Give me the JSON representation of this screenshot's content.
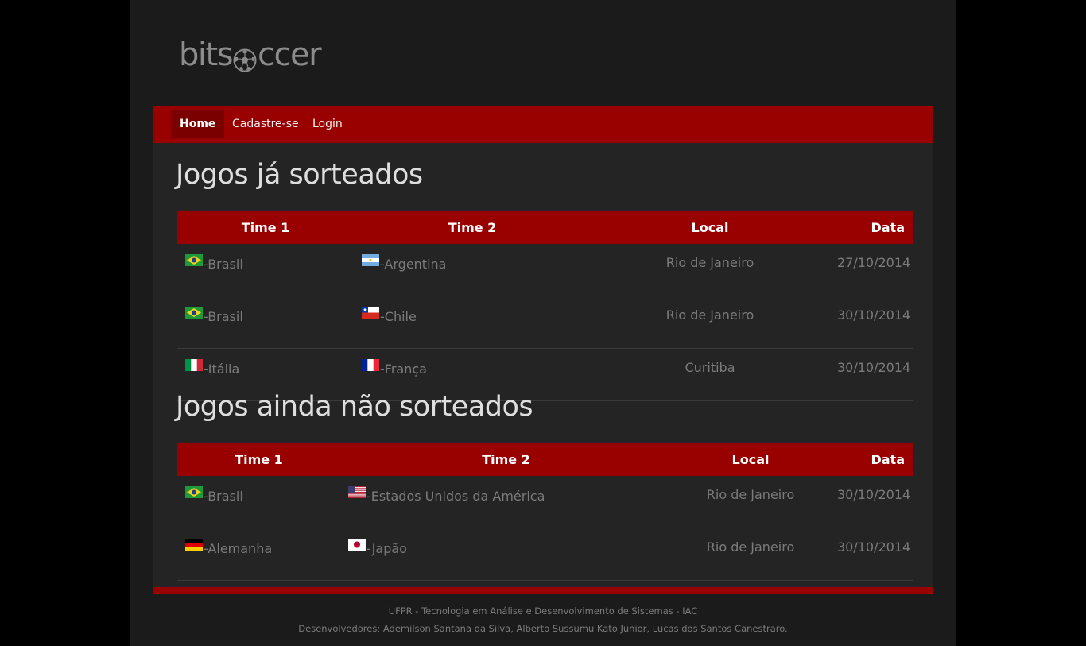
{
  "brand": {
    "logo_text_left": "bits",
    "logo_text_right": "ccer",
    "ball_icon": "soccer-ball-icon"
  },
  "nav": {
    "items": [
      {
        "label": "Home",
        "active": true
      },
      {
        "label": "Cadastre-se",
        "active": false
      },
      {
        "label": "Login",
        "active": false
      }
    ]
  },
  "drawn": {
    "title": "Jogos já sorteados",
    "headers": [
      "Time 1",
      "Time 2",
      "Local",
      "Data"
    ],
    "rows": [
      {
        "team1": {
          "flag": "brazil-flag-icon",
          "name": "-Brasil"
        },
        "team2": {
          "flag": "argentina-flag-icon",
          "name": "-Argentina"
        },
        "local": "Rio de Janeiro",
        "data": "27/10/2014"
      },
      {
        "team1": {
          "flag": "brazil-flag-icon",
          "name": "-Brasil"
        },
        "team2": {
          "flag": "chile-flag-icon",
          "name": "-Chile"
        },
        "local": "Rio de Janeiro",
        "data": "30/10/2014"
      },
      {
        "team1": {
          "flag": "italy-flag-icon",
          "name": "-Itália"
        },
        "team2": {
          "flag": "france-flag-icon",
          "name": "-França"
        },
        "local": "Curitiba",
        "data": "30/10/2014"
      }
    ]
  },
  "not_drawn": {
    "title": "Jogos ainda não sorteados",
    "headers": [
      "Time 1",
      "Time 2",
      "Local",
      "Data"
    ],
    "rows": [
      {
        "team1": {
          "flag": "brazil-flag-icon",
          "name": "-Brasil"
        },
        "team2": {
          "flag": "usa-flag-icon",
          "name": "-Estados Unidos da América"
        },
        "local": "Rio de Janeiro",
        "data": "30/10/2014"
      },
      {
        "team1": {
          "flag": "germany-flag-icon",
          "name": "-Alemanha"
        },
        "team2": {
          "flag": "japan-flag-icon",
          "name": "-Japão"
        },
        "local": "Rio de Janeiro",
        "data": "30/10/2014"
      }
    ]
  },
  "footer": {
    "line1": "UFPR - Tecnologia em Análise e Desenvolvimento de Sistemas - IAC",
    "line2": "Desenvolvedores: Ademilson Santana da Silva, Alberto Sussumu Kato Junior, Lucas dos Santos Canestraro."
  },
  "colors": {
    "accent": "#990000",
    "nav_active": "#7a0000",
    "page_bg": "#1b1b1b",
    "content_bg": "#242424"
  }
}
